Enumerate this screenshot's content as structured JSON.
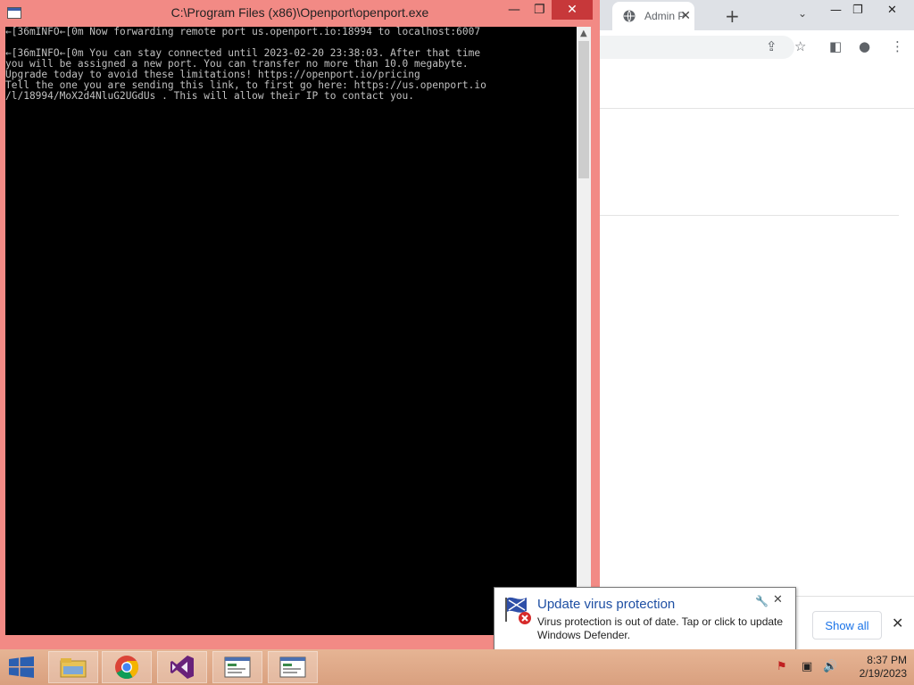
{
  "browser": {
    "tab_title": "Admin P",
    "tab_close": "✕",
    "new_tab": "+",
    "tab_search": "⌄",
    "controls": {
      "minimize": "—",
      "maximize": "❐",
      "close": "✕"
    },
    "toolbar_icons": {
      "share": "⇪",
      "bookmark": "☆",
      "sidepanel": "◧",
      "profile": "●",
      "menu": "⋮"
    },
    "download_bar": {
      "show_all": "Show all",
      "close": "✕"
    }
  },
  "console": {
    "title": "C:\\Program Files (x86)\\Openport\\openport.exe",
    "controls": {
      "minimize": "—",
      "maximize": "❐",
      "close": "✕"
    },
    "lines": [
      "←[36mINFO←[0m Now forwarding remote port us.openport.io:18994 to localhost:6007",
      "",
      "←[36mINFO←[0m You can stay connected until 2023-02-20 23:38:03. After that time",
      "you will be assigned a new port. You can transfer no more than 10.0 megabyte.",
      "Upgrade today to avoid these limitations! https://openport.io/pricing",
      "Tell the one you are sending this link, to first go here: https://us.openport.io",
      "/l/18994/MoX2d4NluG2UGdUs . This will allow their IP to contact you."
    ],
    "scroll_up": "▲"
  },
  "notification": {
    "title": "Update virus protection",
    "body": "Virus protection is out of date. Tap or click to update Windows Defender.",
    "wrench": "🔧",
    "close": "✕"
  },
  "taskbar": {
    "time": "8:37 PM",
    "date": "2/19/2023",
    "tray": {
      "flag": "⚑",
      "network": "▣",
      "volume": "🔊"
    }
  },
  "colors": {
    "console_frame": "#f28a85",
    "close_red": "#c7383a",
    "taskbar": "#d9a07f",
    "link_blue": "#1a73e8"
  }
}
